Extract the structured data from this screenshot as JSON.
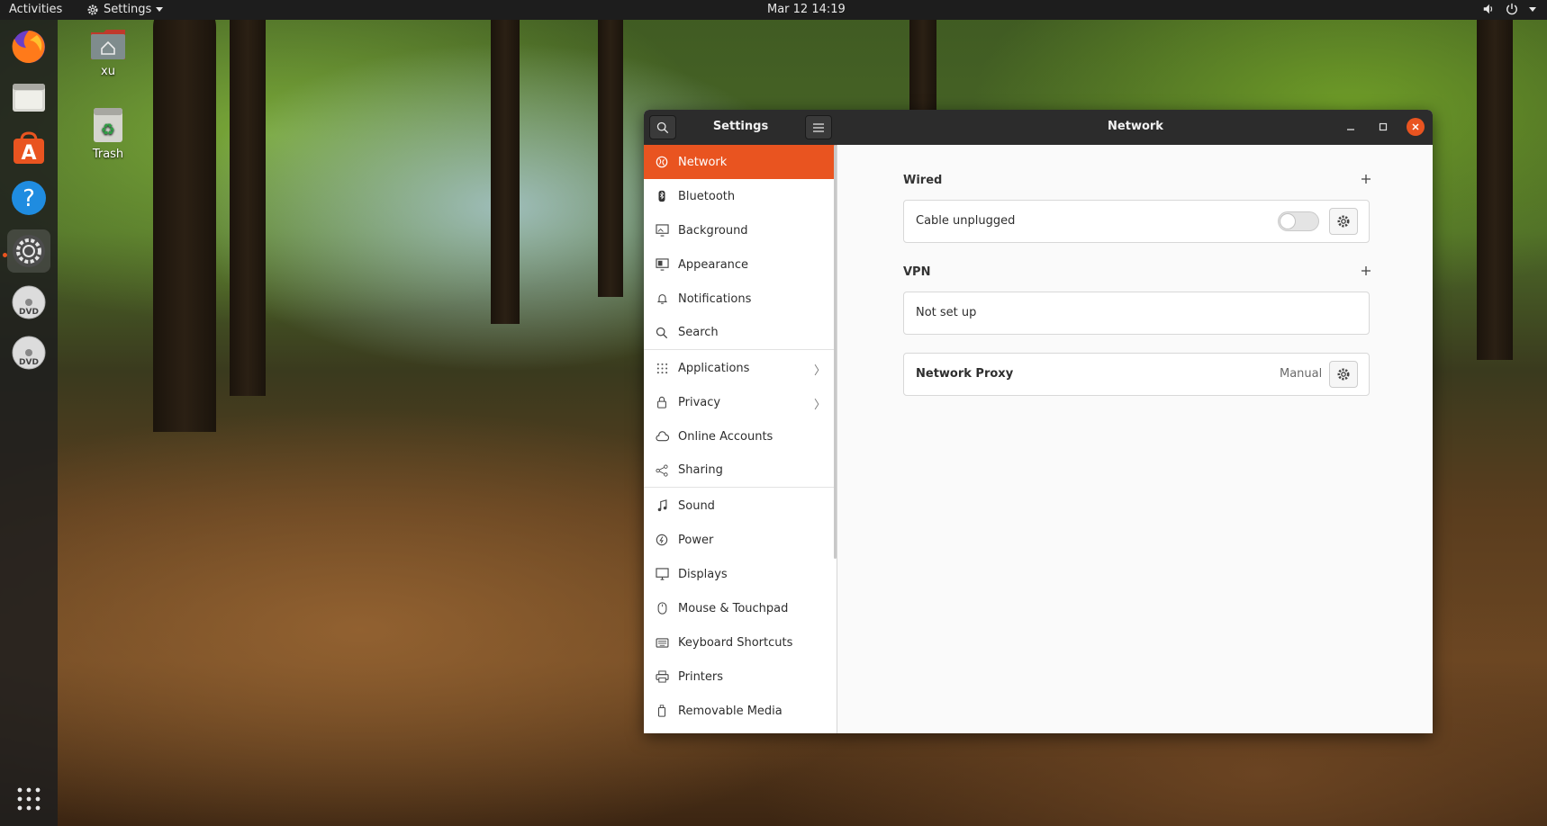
{
  "topbar": {
    "activities": "Activities",
    "app_menu": "Settings",
    "clock": "Mar 12  14:19"
  },
  "desktop": {
    "home_label": "xu",
    "trash_label": "Trash"
  },
  "dock": {
    "items": [
      "firefox-icon",
      "files-icon",
      "software-center-icon",
      "help-icon",
      "settings-icon",
      "dvd-icon",
      "dvd-icon",
      "show-apps-icon"
    ],
    "dvd_label": "DVD"
  },
  "window": {
    "sidebar_title": "Settings",
    "panel_title": "Network"
  },
  "sidebar": {
    "items": [
      {
        "label": "Network",
        "icon": "network-icon"
      },
      {
        "label": "Bluetooth",
        "icon": "bluetooth-icon"
      },
      {
        "label": "Background",
        "icon": "background-icon"
      },
      {
        "label": "Appearance",
        "icon": "appearance-icon"
      },
      {
        "label": "Notifications",
        "icon": "bell-icon"
      },
      {
        "label": "Search",
        "icon": "search-icon"
      },
      {
        "label": "Applications",
        "icon": "apps-grid-icon"
      },
      {
        "label": "Privacy",
        "icon": "lock-icon"
      },
      {
        "label": "Online Accounts",
        "icon": "cloud-icon"
      },
      {
        "label": "Sharing",
        "icon": "share-icon"
      },
      {
        "label": "Sound",
        "icon": "music-note-icon"
      },
      {
        "label": "Power",
        "icon": "power-icon"
      },
      {
        "label": "Displays",
        "icon": "display-icon"
      },
      {
        "label": "Mouse & Touchpad",
        "icon": "mouse-icon"
      },
      {
        "label": "Keyboard Shortcuts",
        "icon": "keyboard-icon"
      },
      {
        "label": "Printers",
        "icon": "printer-icon"
      },
      {
        "label": "Removable Media",
        "icon": "usb-icon"
      }
    ]
  },
  "network": {
    "wired_title": "Wired",
    "wired_status": "Cable unplugged",
    "vpn_title": "VPN",
    "vpn_status": "Not set up",
    "proxy_title": "Network Proxy",
    "proxy_value": "Manual"
  },
  "colors": {
    "accent": "#e95420",
    "headerbar": "#2c2c2c",
    "topbar": "#1d1d1d"
  }
}
